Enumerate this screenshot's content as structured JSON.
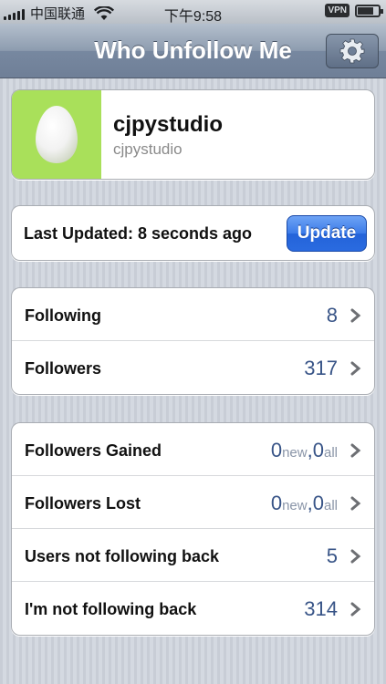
{
  "status_bar": {
    "carrier": "中国联通",
    "time": "下午9:58",
    "vpn": "VPN"
  },
  "nav": {
    "title": "Who Unfollow Me",
    "settings_icon": "gear-icon"
  },
  "profile": {
    "username": "cjpystudio",
    "screen_name": "cjpystudio",
    "avatar_color": "#a9e05a"
  },
  "update": {
    "last_updated": "Last Updated: 8 seconds ago",
    "button_label": "Update"
  },
  "stats": [
    {
      "label": "Following",
      "value": "8"
    },
    {
      "label": "Followers",
      "value": "317"
    }
  ],
  "changes": [
    {
      "label": "Followers Gained",
      "new_count": "0",
      "new_label": "new",
      "separator": ",",
      "all_count": "0",
      "all_label": "all"
    },
    {
      "label": "Followers Lost",
      "new_count": "0",
      "new_label": "new",
      "separator": ",",
      "all_count": "0",
      "all_label": "all"
    },
    {
      "label": "Users not following back",
      "value": "5"
    },
    {
      "label": "I'm not following back",
      "value": "314"
    }
  ],
  "colors": {
    "nav_bar": "#7788a0",
    "update_button": "#2a6be0",
    "value_text": "#385487"
  }
}
